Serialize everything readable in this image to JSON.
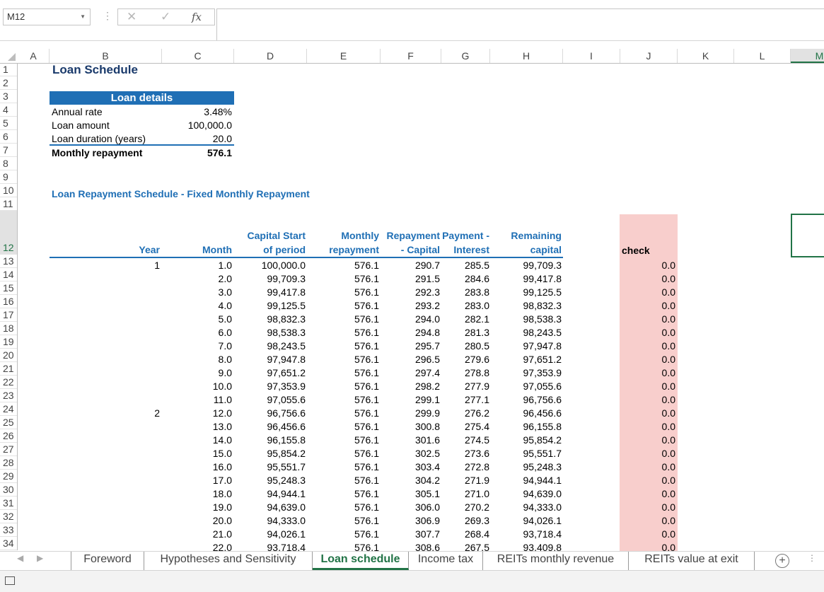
{
  "formula_bar": {
    "name_box": "M12",
    "fx": "fx",
    "cancel": "✕",
    "enter": "✓"
  },
  "columns": [
    "A",
    "B",
    "C",
    "D",
    "E",
    "F",
    "G",
    "H",
    "I",
    "J",
    "K",
    "L",
    "M"
  ],
  "rows": [
    "1",
    "2",
    "3",
    "4",
    "5",
    "6",
    "7",
    "8",
    "9",
    "10",
    "11",
    "12",
    "13",
    "14",
    "15",
    "16",
    "17",
    "18",
    "19",
    "20",
    "21",
    "22",
    "23",
    "24",
    "25",
    "26",
    "27",
    "28",
    "29",
    "30",
    "31",
    "32",
    "33",
    "34"
  ],
  "sheet": {
    "title": "Loan Schedule",
    "loan_details": {
      "header": "Loan details",
      "items": [
        {
          "label": "Annual rate",
          "value": "3.48%"
        },
        {
          "label": "Loan amount",
          "value": "100,000.0"
        },
        {
          "label": "Loan duration (years)",
          "value": "20.0"
        }
      ],
      "monthly_label": "Monthly repayment",
      "monthly_value": "576.1"
    },
    "schedule_title": "Loan Repayment Schedule - Fixed Monthly Repayment",
    "headers": {
      "year": "Year",
      "month": "Month",
      "cap_start_1": "Capital Start",
      "cap_start_2": "of period",
      "monthly_1": "Monthly",
      "monthly_2": "repayment",
      "repay_1": "Repayment",
      "repay_2": "- Capital",
      "interest_1": "Payment -",
      "interest_2": "Interest",
      "remain_1": "Remaining",
      "remain_2": "capital",
      "check": "check"
    },
    "table": [
      {
        "year": "1",
        "month": "1.0",
        "start": "100,000.0",
        "pay": "576.1",
        "capital": "290.7",
        "interest": "285.5",
        "remaining": "99,709.3",
        "check": "0.0"
      },
      {
        "year": "",
        "month": "2.0",
        "start": "99,709.3",
        "pay": "576.1",
        "capital": "291.5",
        "interest": "284.6",
        "remaining": "99,417.8",
        "check": "0.0"
      },
      {
        "year": "",
        "month": "3.0",
        "start": "99,417.8",
        "pay": "576.1",
        "capital": "292.3",
        "interest": "283.8",
        "remaining": "99,125.5",
        "check": "0.0"
      },
      {
        "year": "",
        "month": "4.0",
        "start": "99,125.5",
        "pay": "576.1",
        "capital": "293.2",
        "interest": "283.0",
        "remaining": "98,832.3",
        "check": "0.0"
      },
      {
        "year": "",
        "month": "5.0",
        "start": "98,832.3",
        "pay": "576.1",
        "capital": "294.0",
        "interest": "282.1",
        "remaining": "98,538.3",
        "check": "0.0"
      },
      {
        "year": "",
        "month": "6.0",
        "start": "98,538.3",
        "pay": "576.1",
        "capital": "294.8",
        "interest": "281.3",
        "remaining": "98,243.5",
        "check": "0.0"
      },
      {
        "year": "",
        "month": "7.0",
        "start": "98,243.5",
        "pay": "576.1",
        "capital": "295.7",
        "interest": "280.5",
        "remaining": "97,947.8",
        "check": "0.0"
      },
      {
        "year": "",
        "month": "8.0",
        "start": "97,947.8",
        "pay": "576.1",
        "capital": "296.5",
        "interest": "279.6",
        "remaining": "97,651.2",
        "check": "0.0"
      },
      {
        "year": "",
        "month": "9.0",
        "start": "97,651.2",
        "pay": "576.1",
        "capital": "297.4",
        "interest": "278.8",
        "remaining": "97,353.9",
        "check": "0.0"
      },
      {
        "year": "",
        "month": "10.0",
        "start": "97,353.9",
        "pay": "576.1",
        "capital": "298.2",
        "interest": "277.9",
        "remaining": "97,055.6",
        "check": "0.0"
      },
      {
        "year": "",
        "month": "11.0",
        "start": "97,055.6",
        "pay": "576.1",
        "capital": "299.1",
        "interest": "277.1",
        "remaining": "96,756.6",
        "check": "0.0"
      },
      {
        "year": "2",
        "month": "12.0",
        "start": "96,756.6",
        "pay": "576.1",
        "capital": "299.9",
        "interest": "276.2",
        "remaining": "96,456.6",
        "check": "0.0"
      },
      {
        "year": "",
        "month": "13.0",
        "start": "96,456.6",
        "pay": "576.1",
        "capital": "300.8",
        "interest": "275.4",
        "remaining": "96,155.8",
        "check": "0.0"
      },
      {
        "year": "",
        "month": "14.0",
        "start": "96,155.8",
        "pay": "576.1",
        "capital": "301.6",
        "interest": "274.5",
        "remaining": "95,854.2",
        "check": "0.0"
      },
      {
        "year": "",
        "month": "15.0",
        "start": "95,854.2",
        "pay": "576.1",
        "capital": "302.5",
        "interest": "273.6",
        "remaining": "95,551.7",
        "check": "0.0"
      },
      {
        "year": "",
        "month": "16.0",
        "start": "95,551.7",
        "pay": "576.1",
        "capital": "303.4",
        "interest": "272.8",
        "remaining": "95,248.3",
        "check": "0.0"
      },
      {
        "year": "",
        "month": "17.0",
        "start": "95,248.3",
        "pay": "576.1",
        "capital": "304.2",
        "interest": "271.9",
        "remaining": "94,944.1",
        "check": "0.0"
      },
      {
        "year": "",
        "month": "18.0",
        "start": "94,944.1",
        "pay": "576.1",
        "capital": "305.1",
        "interest": "271.0",
        "remaining": "94,639.0",
        "check": "0.0"
      },
      {
        "year": "",
        "month": "19.0",
        "start": "94,639.0",
        "pay": "576.1",
        "capital": "306.0",
        "interest": "270.2",
        "remaining": "94,333.0",
        "check": "0.0"
      },
      {
        "year": "",
        "month": "20.0",
        "start": "94,333.0",
        "pay": "576.1",
        "capital": "306.9",
        "interest": "269.3",
        "remaining": "94,026.1",
        "check": "0.0"
      },
      {
        "year": "",
        "month": "21.0",
        "start": "94,026.1",
        "pay": "576.1",
        "capital": "307.7",
        "interest": "268.4",
        "remaining": "93,718.4",
        "check": "0.0"
      },
      {
        "year": "",
        "month": "22.0",
        "start": "93,718.4",
        "pay": "576.1",
        "capital": "308.6",
        "interest": "267.5",
        "remaining": "93,409.8",
        "check": "0.0"
      }
    ]
  },
  "tabs": [
    {
      "label": "Foreword",
      "active": false
    },
    {
      "label": "Hypotheses and Sensitivity",
      "active": false
    },
    {
      "label": "Loan schedule",
      "active": true
    },
    {
      "label": "Income tax",
      "active": false
    },
    {
      "label": "REITs monthly revenue",
      "active": false
    },
    {
      "label": "REITs value at exit",
      "active": false
    }
  ],
  "colors": {
    "accent": "#1F6FB5",
    "check_fill": "#F8CECC",
    "excel_green": "#217346"
  }
}
